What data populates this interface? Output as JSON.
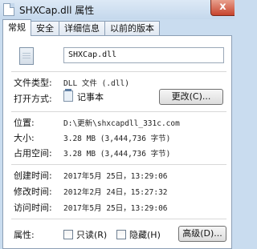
{
  "window": {
    "title": "SHXCap.dll 属性",
    "close": "x"
  },
  "tabs": [
    "常规",
    "安全",
    "详细信息",
    "以前的版本"
  ],
  "file": {
    "name": "SHXCap.dll"
  },
  "rows": {
    "file_type": {
      "label": "文件类型:",
      "value": "DLL 文件 (.dll)"
    },
    "open_with": {
      "label": "打开方式:",
      "app": "记事本",
      "button": "更改(C)..."
    },
    "location": {
      "label": "位置:",
      "value": "D:\\更新\\shxcapdll_331c.com"
    },
    "size": {
      "label": "大小:",
      "value": "3.28 MB (3,444,736 字节)"
    },
    "size_on_disk": {
      "label": "占用空间:",
      "value": "3.28 MB (3,444,736 字节)"
    },
    "created": {
      "label": "创建时间:",
      "value": "2017年5月 25日，13:29:06"
    },
    "modified": {
      "label": "修改时间:",
      "value": "2012年2月 24日，15:27:32"
    },
    "accessed": {
      "label": "访问时间:",
      "value": "2017年5月 25日，13:29:06"
    },
    "attributes": {
      "label": "属性:",
      "readonly": "只读(R)",
      "hidden": "隐藏(H)",
      "advanced": "高级(D)..."
    }
  },
  "icons": {
    "title": "dll-file-icon",
    "file": "dll-file-icon",
    "open_with": "notepad-icon"
  }
}
